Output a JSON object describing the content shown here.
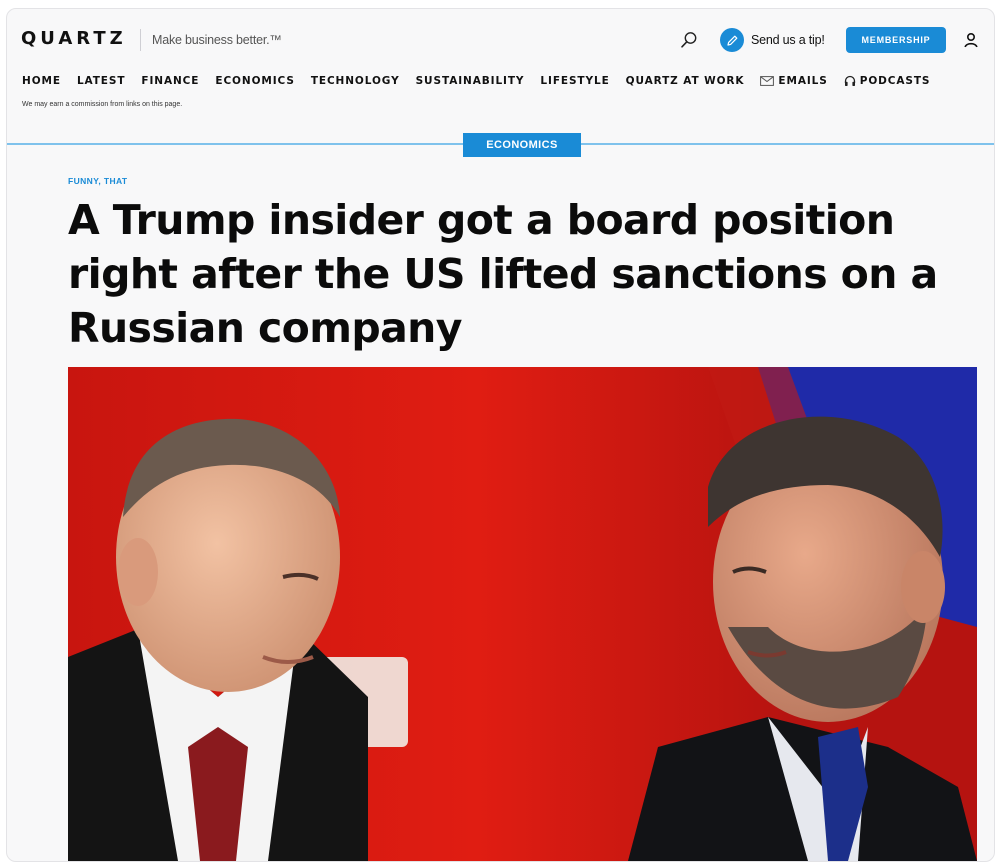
{
  "header": {
    "logo": "QUARTZ",
    "tagline": "Make business better.™",
    "tip_label": "Send us a tip!",
    "membership_label": "MEMBERSHIP",
    "accent_color": "#1a8bd6"
  },
  "nav": {
    "items": [
      {
        "label": "HOME"
      },
      {
        "label": "LATEST"
      },
      {
        "label": "FINANCE"
      },
      {
        "label": "ECONOMICS"
      },
      {
        "label": "TECHNOLOGY"
      },
      {
        "label": "SUSTAINABILITY"
      },
      {
        "label": "LIFESTYLE"
      },
      {
        "label": "QUARTZ AT WORK"
      },
      {
        "label": "EMAILS",
        "icon": "envelope-icon"
      },
      {
        "label": "PODCASTS",
        "icon": "headphones-icon"
      }
    ]
  },
  "disclaimer": "We may earn a commission from links on this page.",
  "article": {
    "section": "ECONOMICS",
    "kicker": "FUNNY, THAT",
    "headline": "A Trump insider got a board position right after the US lifted sanctions on a Russian company"
  },
  "icons": {
    "search": "search-icon",
    "tip": "pencil-icon",
    "user": "user-icon"
  }
}
